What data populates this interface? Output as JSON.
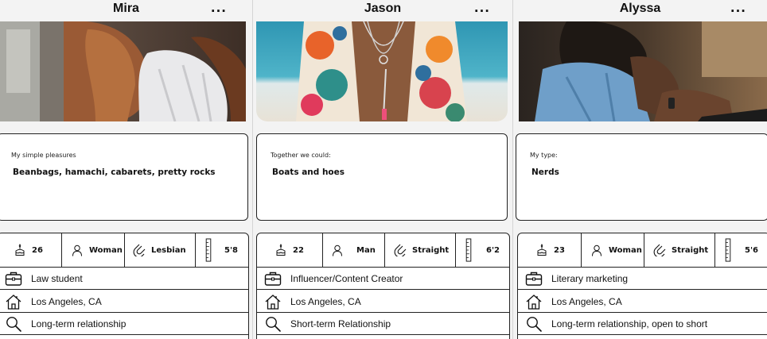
{
  "colors": {
    "background": "#f3f3f3",
    "card": "#ffffff",
    "border": "#222222"
  },
  "profiles": [
    {
      "name": "Mira",
      "more": "...",
      "prompt": {
        "question": "My simple pleasures",
        "answer": "Beanbags, hamachi, cabarets, pretty rocks"
      },
      "age": "26",
      "gender": "Woman",
      "orientation": "Lesbian",
      "height": "5'8",
      "job": "Law student",
      "location": "Los Angeles, CA",
      "looking_for": "Long-term relationship",
      "icons": [
        "cake-icon",
        "person-icon",
        "magnet-icon",
        "ruler-icon",
        "briefcase-icon",
        "home-icon",
        "search-icon"
      ]
    },
    {
      "name": "Jason",
      "more": "...",
      "prompt": {
        "question": "Together we could:",
        "answer": "Boats and hoes"
      },
      "age": "22",
      "gender": "Man",
      "orientation": "Straight",
      "height": "6'2",
      "job": "Influencer/Content Creator",
      "location": "Los Angeles, CA",
      "looking_for": "Short-term Relationship",
      "icons": [
        "cake-icon",
        "person-icon",
        "magnet-icon",
        "ruler-icon",
        "briefcase-icon",
        "home-icon",
        "search-icon"
      ]
    },
    {
      "name": "Alyssa",
      "more": "...",
      "prompt": {
        "question": "My type:",
        "answer": "Nerds"
      },
      "age": "23",
      "gender": "Woman",
      "orientation": "Straight",
      "height": "5'6",
      "job": "Literary marketing",
      "location": "Los Angeles, CA",
      "looking_for": "Long-term relationship, open to short",
      "icons": [
        "cake-icon",
        "person-icon",
        "magnet-icon",
        "ruler-icon",
        "briefcase-icon",
        "home-icon",
        "search-icon"
      ]
    }
  ]
}
